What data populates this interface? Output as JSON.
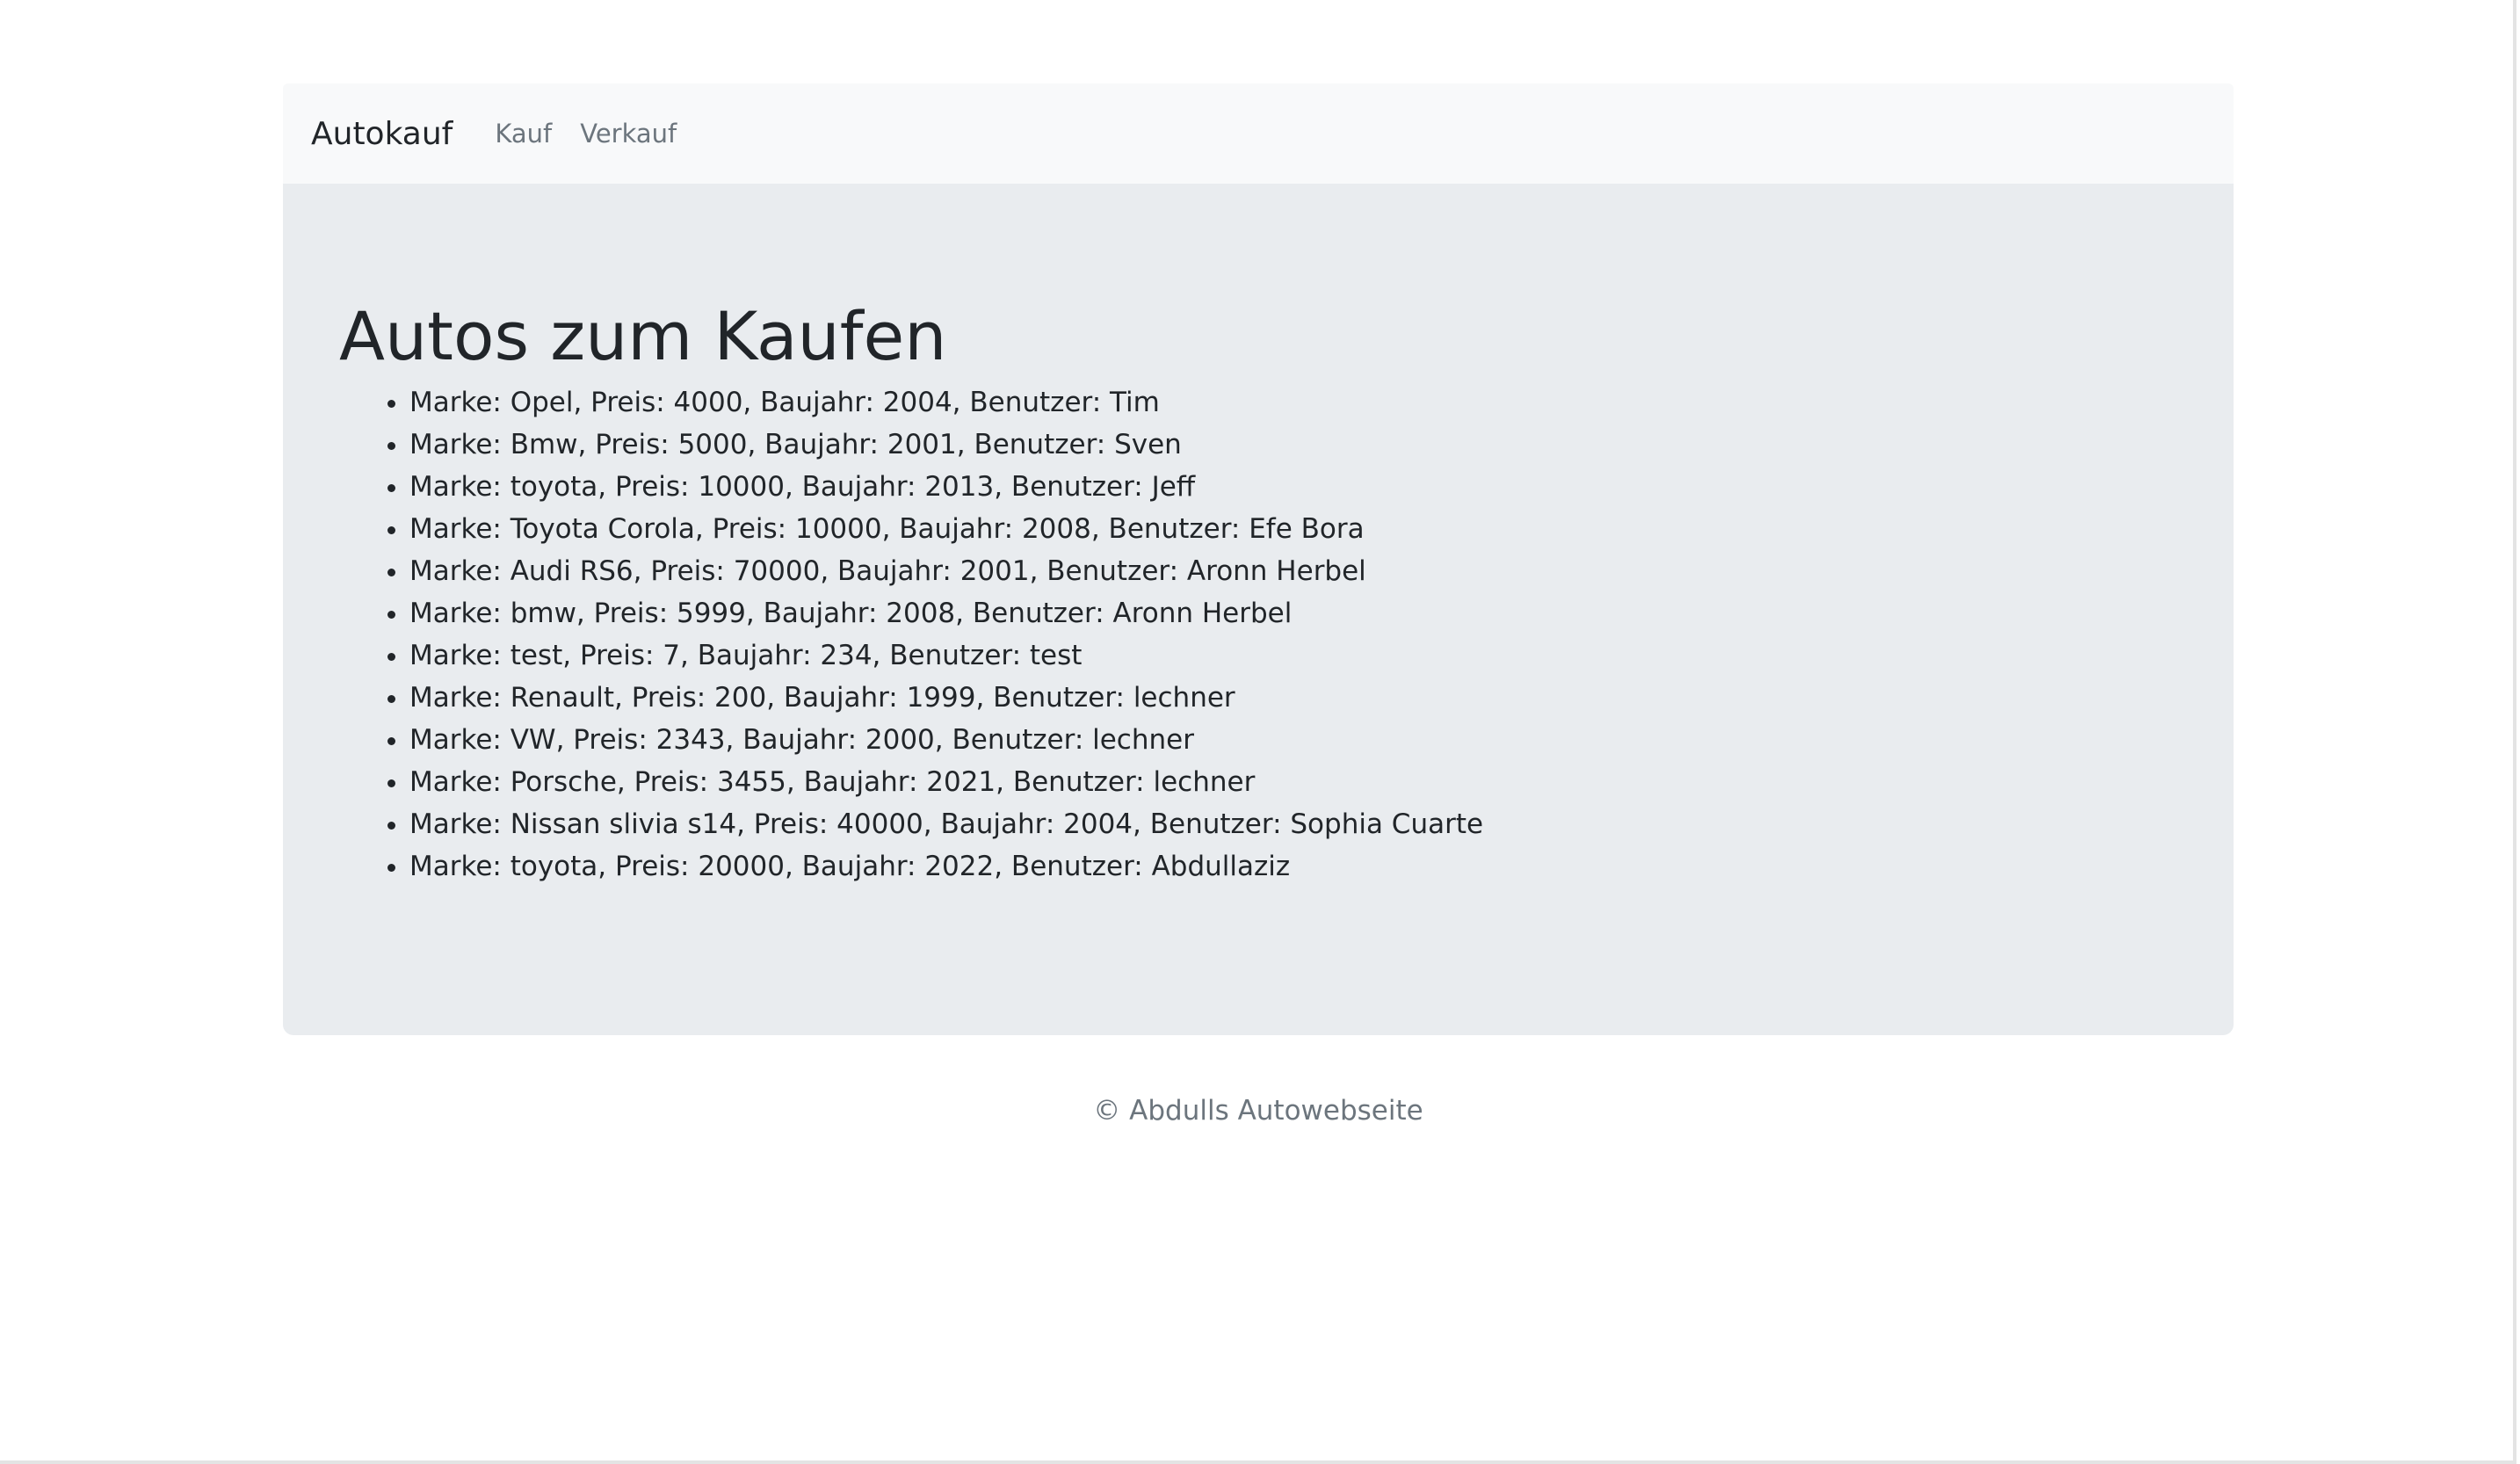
{
  "navbar": {
    "brand": "Autokauf",
    "links": [
      "Kauf",
      "Verkauf"
    ]
  },
  "main": {
    "title": "Autos zum Kaufen",
    "cars": [
      "Marke: Opel, Preis: 4000, Baujahr: 2004, Benutzer: Tim",
      "Marke: Bmw, Preis: 5000, Baujahr: 2001, Benutzer: Sven",
      "Marke: toyota, Preis: 10000, Baujahr: 2013, Benutzer: Jeff",
      "Marke: Toyota Corola, Preis: 10000, Baujahr: 2008, Benutzer: Efe Bora",
      "Marke: Audi RS6, Preis: 70000, Baujahr: 2001, Benutzer: Aronn Herbel",
      "Marke: bmw, Preis: 5999, Baujahr: 2008, Benutzer: Aronn Herbel",
      "Marke: test, Preis: 7, Baujahr: 234, Benutzer: test",
      "Marke: Renault, Preis: 200, Baujahr: 1999, Benutzer: lechner",
      "Marke: VW, Preis: 2343, Baujahr: 2000, Benutzer: lechner",
      "Marke: Porsche, Preis: 3455, Baujahr: 2021, Benutzer: lechner",
      "Marke: Nissan slivia s14, Preis: 40000, Baujahr: 2004, Benutzer: Sophia Cuarte",
      "Marke: toyota, Preis: 20000, Baujahr: 2022, Benutzer: Abdullaziz"
    ]
  },
  "footer": {
    "text": "© Abdulls Autowebseite"
  }
}
